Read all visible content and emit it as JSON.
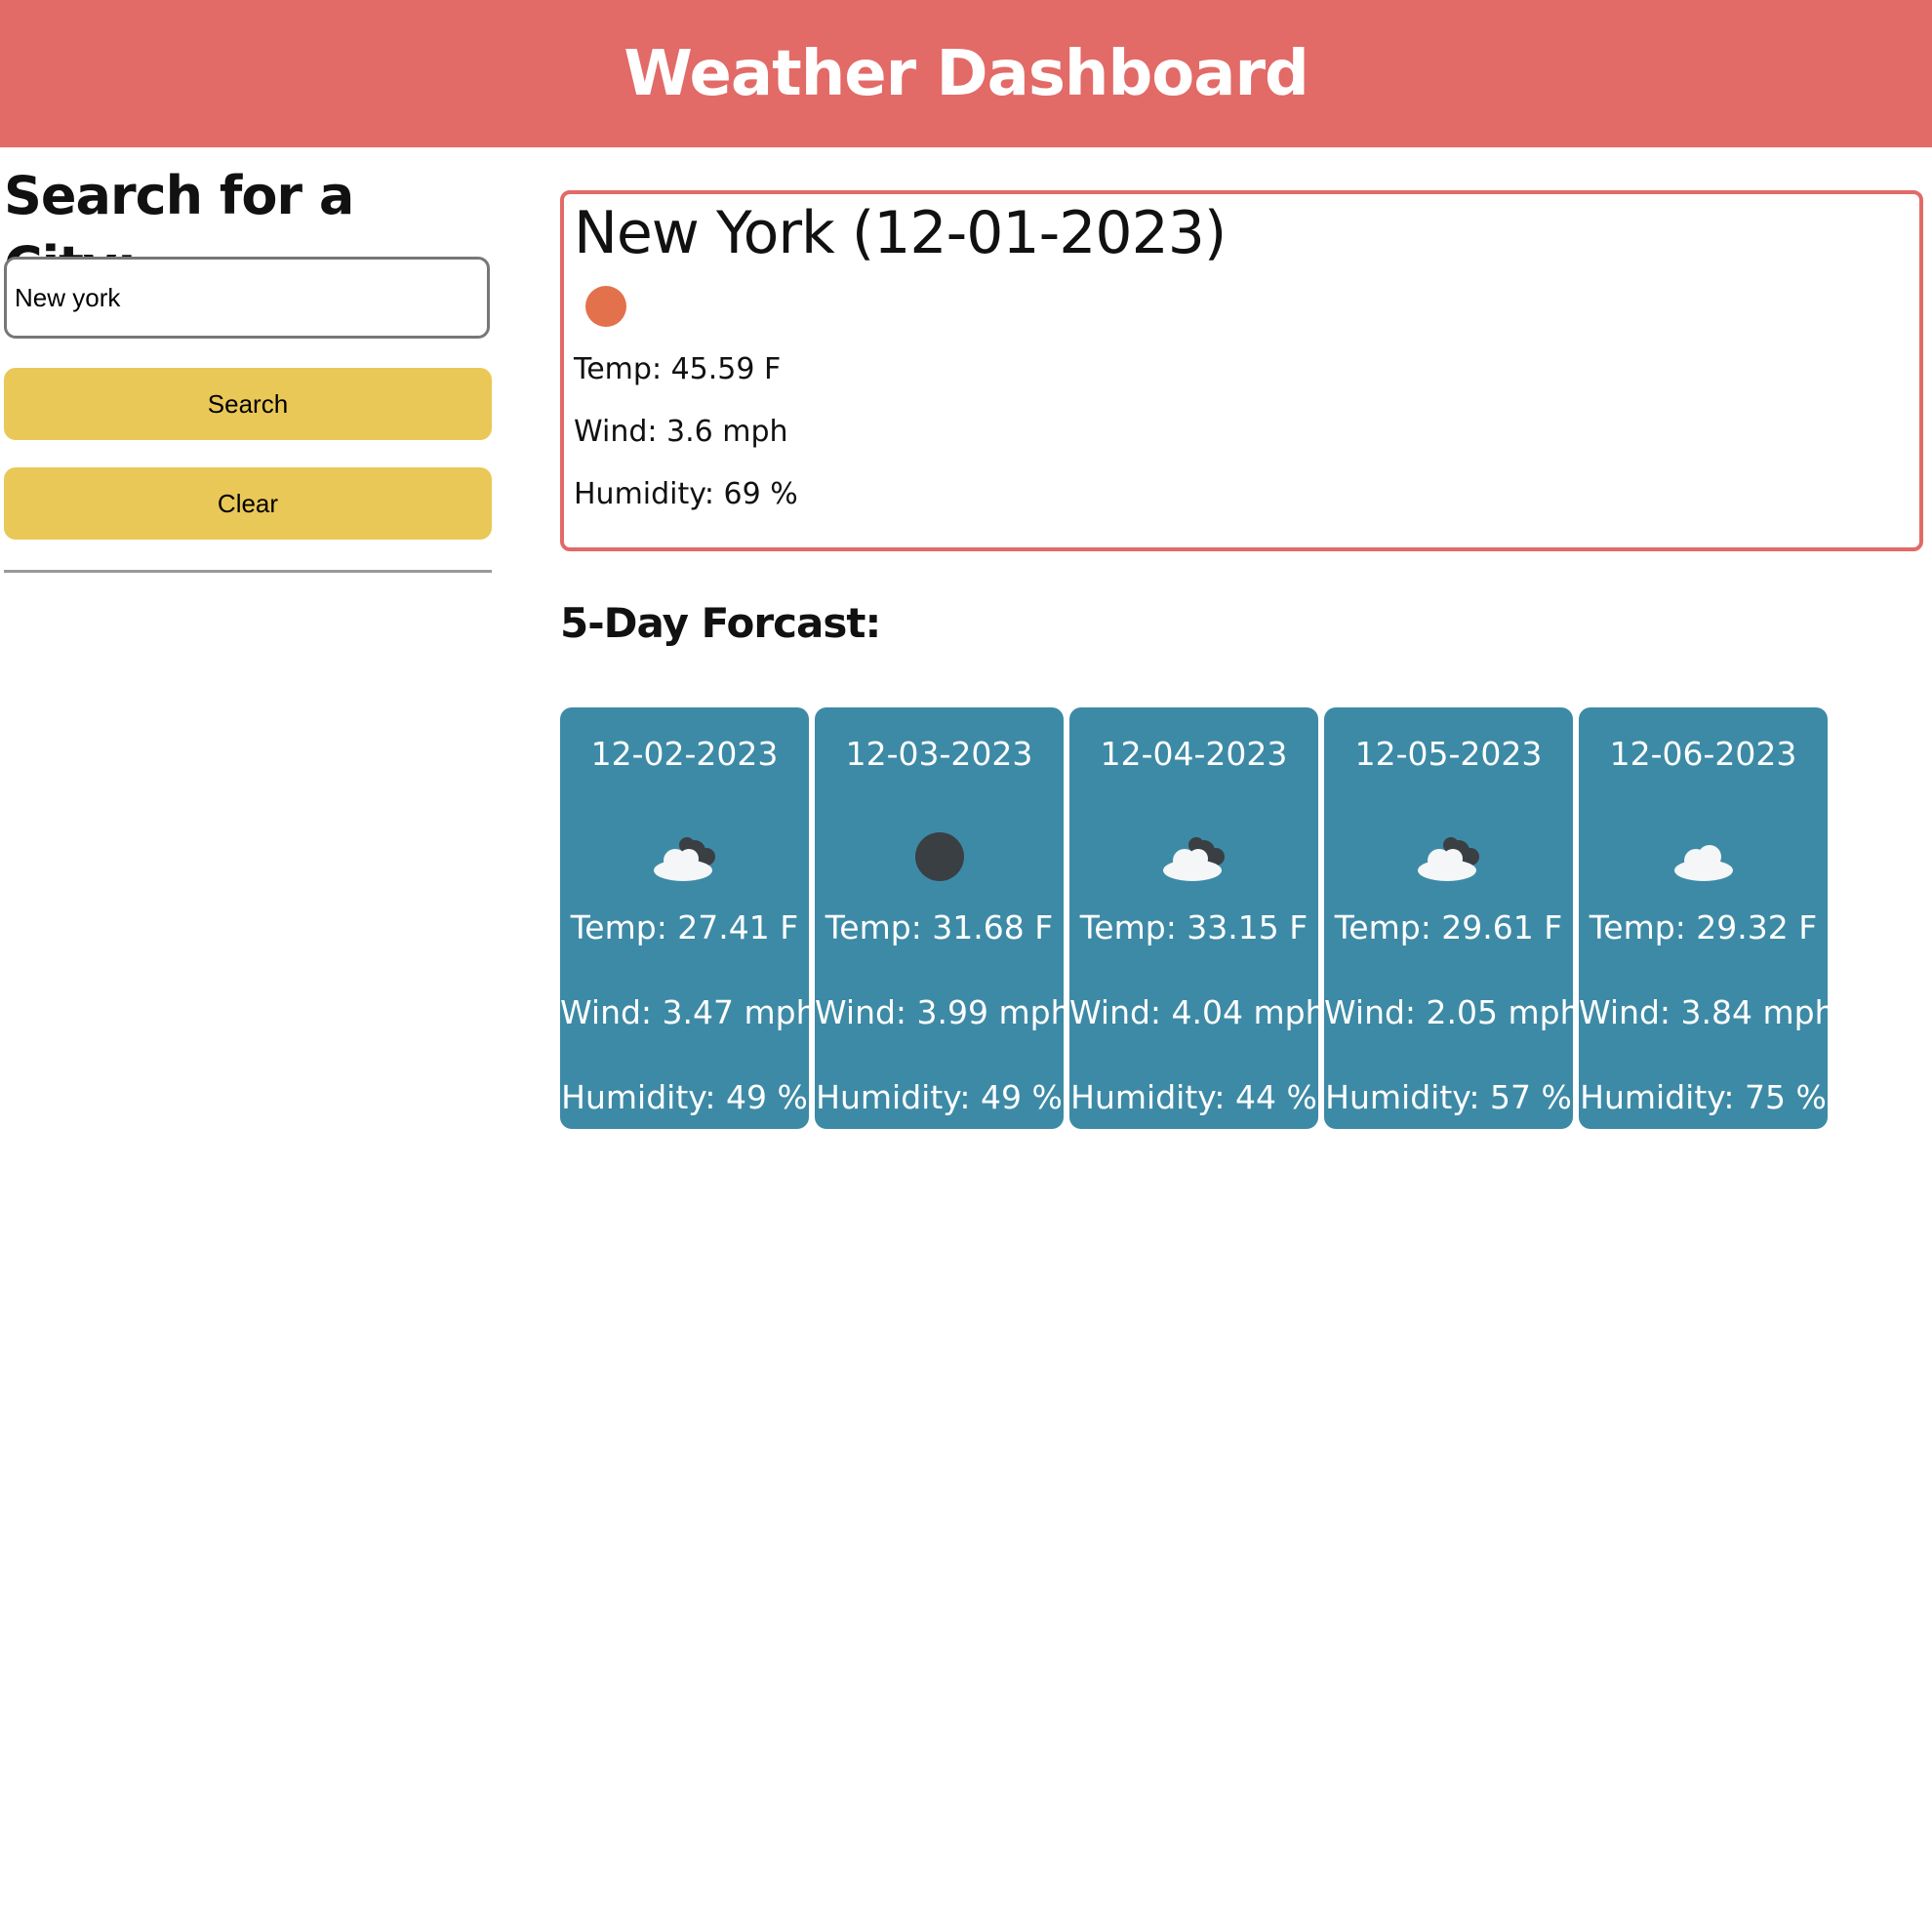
{
  "colors": {
    "header_bg": "#e26a67",
    "accent": "#e26a67",
    "button_bg": "#e9c857",
    "forecast_card_bg": "#3d8aa6"
  },
  "header": {
    "title": "Weather Dashboard"
  },
  "search": {
    "heading": "Search for a City:",
    "input_value": "New york",
    "search_label": "Search",
    "clear_label": "Clear"
  },
  "current": {
    "title": "New York (12-01-2023)",
    "icon": "sun-icon",
    "temp": "Temp: 45.59 F",
    "wind": "Wind: 3.6 mph",
    "humidity": "Humidity: 69 %"
  },
  "forecast": {
    "heading": "5-Day Forcast:",
    "days": [
      {
        "date": "12-02-2023",
        "icon": "partly-cloudy-icon",
        "temp": "Temp: 27.41 F",
        "wind": "Wind: 3.47 mph",
        "humidity": "Humidity: 49 %"
      },
      {
        "date": "12-03-2023",
        "icon": "moon-icon",
        "temp": "Temp: 31.68 F",
        "wind": "Wind: 3.99 mph",
        "humidity": "Humidity: 49 %"
      },
      {
        "date": "12-04-2023",
        "icon": "partly-cloudy-icon",
        "temp": "Temp: 33.15 F",
        "wind": "Wind: 4.04 mph",
        "humidity": "Humidity: 44 %"
      },
      {
        "date": "12-05-2023",
        "icon": "partly-cloudy-icon",
        "temp": "Temp: 29.61 F",
        "wind": "Wind: 2.05 mph",
        "humidity": "Humidity: 57 %"
      },
      {
        "date": "12-06-2023",
        "icon": "cloud-icon",
        "temp": "Temp: 29.32 F",
        "wind": "Wind: 3.84 mph",
        "humidity": "Humidity: 75 %"
      }
    ]
  }
}
